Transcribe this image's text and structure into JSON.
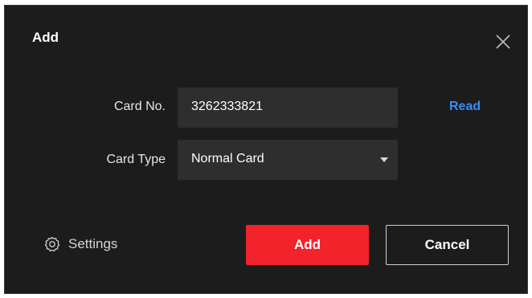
{
  "dialog": {
    "title": "Add",
    "close_icon": "close-icon"
  },
  "form": {
    "card_no": {
      "label": "Card No.",
      "value": "3262333821",
      "read_label": "Read"
    },
    "card_type": {
      "label": "Card Type",
      "selected": "Normal Card"
    }
  },
  "footer": {
    "settings_label": "Settings",
    "settings_icon": "gear-icon",
    "add_label": "Add",
    "cancel_label": "Cancel"
  },
  "colors": {
    "background": "#1c1c1c",
    "field": "#2e2e2e",
    "accent_link": "#3c8bf0",
    "primary_button": "#f2232b"
  }
}
